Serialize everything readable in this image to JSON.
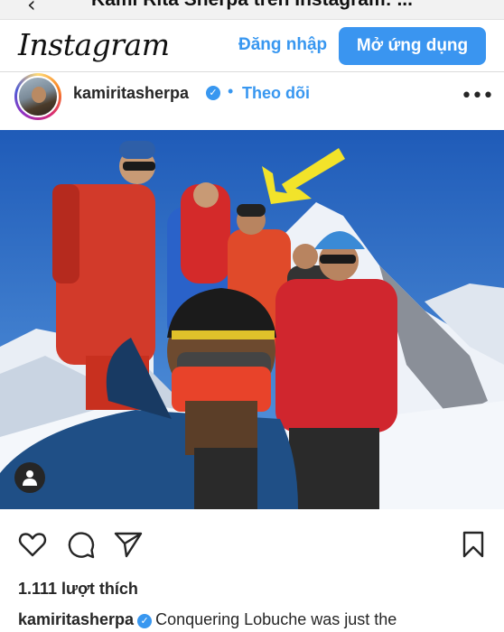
{
  "browser": {
    "page_title": "Kami Rita Sherpa trên Instagram: ..."
  },
  "header": {
    "logo_text": "Instagram",
    "login_label": "Đăng nhập",
    "open_app_label": "Mở ứng dụng"
  },
  "post": {
    "username": "kamiritasherpa",
    "separator": "•",
    "follow_label": "Theo dõi",
    "more_icon": "more-horizontal-icon",
    "verified_icon": "verified-check-icon"
  },
  "actions": {
    "like_icon": "heart-icon",
    "comment_icon": "comment-icon",
    "share_icon": "send-icon",
    "save_icon": "bookmark-icon"
  },
  "likes_text": "1.111 lượt thích",
  "caption": {
    "username": "kamiritasherpa",
    "text": "Conquering Lobuche was just the"
  },
  "colors": {
    "accent": "#3897f0",
    "button_bg": "#3a95f0",
    "text": "#262626"
  }
}
